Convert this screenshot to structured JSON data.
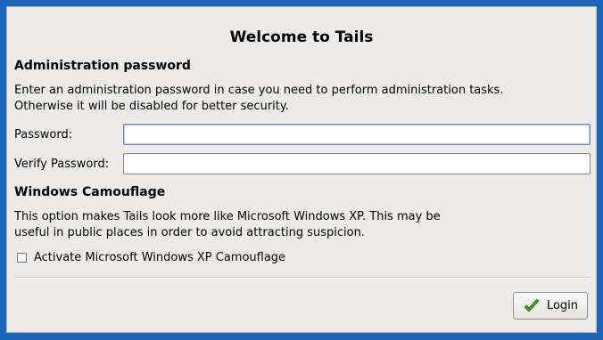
{
  "window": {
    "title": "Welcome to Tails"
  },
  "admin_section": {
    "heading": "Administration password",
    "description_line1": "Enter an administration password in case you need to perform administration tasks.",
    "description_line2": "Otherwise it will be disabled for better security.",
    "password_label": "Password:",
    "password_value": "",
    "verify_label": "Verify Password:",
    "verify_value": ""
  },
  "camouflage_section": {
    "heading": "Windows Camouflage",
    "description_line1": "This option makes Tails look more like Microsoft Windows XP. This may be",
    "description_line2": "useful in public places in order to avoid attracting suspicion.",
    "checkbox_label": "Activate Microsoft Windows XP Camouflage",
    "checked": false
  },
  "footer": {
    "login_label": "Login",
    "login_icon": "check-icon"
  },
  "colors": {
    "background": "#1a66b8",
    "dialog": "#edeceb",
    "check_green": "#4a9a1c"
  }
}
